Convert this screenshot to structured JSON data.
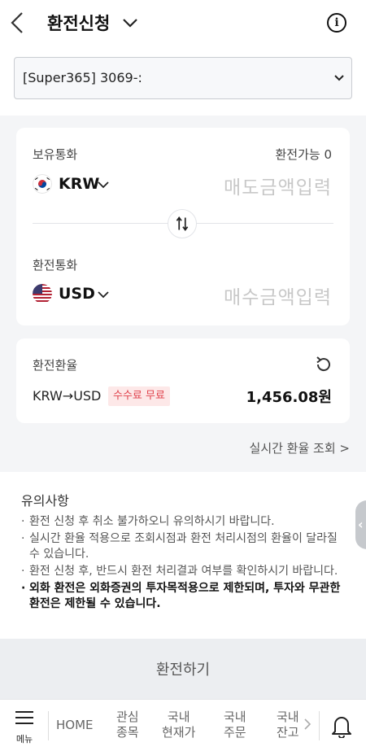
{
  "header": {
    "title": "환전신청",
    "info_icon": "ⓘ"
  },
  "account": {
    "selected": "[Super365] 3069-:"
  },
  "exchange_card": {
    "from_label": "보유통화",
    "available_text": "환전가능 0",
    "from_currency": "KRW",
    "from_placeholder": "매도금액입력",
    "to_label": "환전통화",
    "to_currency": "USD",
    "to_placeholder": "매수금액입력"
  },
  "rate_card": {
    "label": "환전환율",
    "pair": "KRW→USD",
    "fee_badge": "수수료 무료",
    "rate": "1,456.08원"
  },
  "realtime_link": "실시간 환율 조회 >",
  "notice": {
    "title": "유의사항",
    "items": [
      "환전 신청 후 취소 불가하오니 유의하시기 바랍니다.",
      "실시간 환율 적용으로 조회시점과 환전 처리시점의 환율이 달라질 수 있습니다.",
      "환전 신청 후, 반드시 환전 처리결과 여부를 확인하시기 바랍니다.",
      "외화 환전은 외화증권의 투자목적용으로 제한되며, 투자와 무관한 환전은 제한될 수 있습니다."
    ]
  },
  "submit_label": "환전하기",
  "tabbar": {
    "menu_label": "메뉴",
    "home": "HOME",
    "tab1_l1": "관심",
    "tab1_l2": "종목",
    "tab2_l1": "국내",
    "tab2_l2": "현재가",
    "tab3_l1": "국내",
    "tab3_l2": "주문",
    "tab4_l1": "국내",
    "tab4_l2": "잔고"
  },
  "colors": {
    "fee_badge_bg": "#fde8e8",
    "fee_badge_text": "#e0414b",
    "page_bg": "#f4f5f7"
  },
  "icons": [
    "back-arrow-icon",
    "chevron-down-icon",
    "info-icon",
    "korea-flag-icon",
    "usa-flag-icon",
    "swap-icon",
    "refresh-icon",
    "hamburger-menu-icon",
    "bell-icon"
  ]
}
